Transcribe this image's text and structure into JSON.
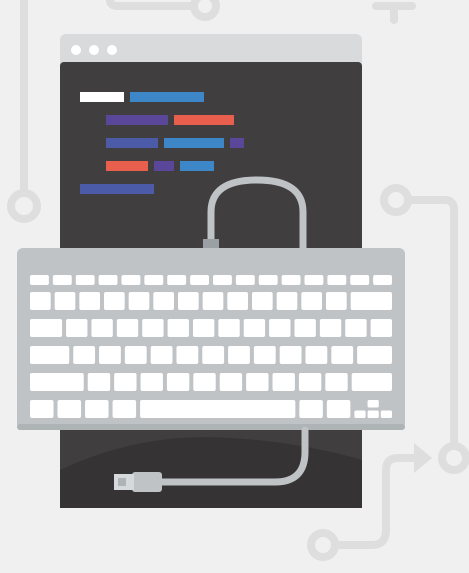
{
  "illustration": {
    "colors": {
      "background": "#f0f0f0",
      "circuit": "#dedede",
      "window_titlebar": "#d9dadb",
      "window_body": "#403e3f",
      "titlebar_dots": "#ffffff",
      "keyboard_body": "#bfc3c6",
      "keyboard_keys": "#ffffff",
      "cable": "#bfc3c6",
      "code_white": "#ffffff",
      "code_blue": "#3d87c8",
      "code_purple": "#5b479a",
      "code_red": "#e8604d",
      "code_navy": "#4b5ba8"
    },
    "window": {
      "titlebar_dots": 3
    },
    "code_lines": [
      {
        "indent": 0,
        "tokens": [
          {
            "color": "code_white"
          },
          {
            "color": "code_blue"
          }
        ]
      },
      {
        "indent": 1,
        "tokens": [
          {
            "color": "code_purple"
          },
          {
            "color": "code_red"
          }
        ]
      },
      {
        "indent": 1,
        "tokens": [
          {
            "color": "code_navy"
          },
          {
            "color": "code_blue"
          },
          {
            "color": "code_purple"
          }
        ]
      },
      {
        "indent": 1,
        "tokens": [
          {
            "color": "code_red"
          },
          {
            "color": "code_purple"
          },
          {
            "color": "code_blue"
          }
        ]
      },
      {
        "indent": 0,
        "tokens": [
          {
            "color": "code_navy"
          }
        ]
      }
    ],
    "keyboard": {
      "rows": [
        {
          "kind": "function",
          "key_units": [
            1,
            1,
            1,
            1,
            1,
            1,
            1,
            1,
            1,
            1,
            1,
            1,
            1,
            1,
            1,
            1
          ]
        },
        {
          "kind": "number",
          "key_units": [
            1,
            1,
            1,
            1,
            1,
            1,
            1,
            1,
            1,
            1,
            1,
            1,
            1,
            2
          ]
        },
        {
          "kind": "top-letters",
          "key_units": [
            1.5,
            1,
            1,
            1,
            1,
            1,
            1,
            1,
            1,
            1,
            1,
            1,
            1,
            1
          ]
        },
        {
          "kind": "home-row",
          "key_units": [
            1.8,
            1,
            1,
            1,
            1,
            1,
            1,
            1,
            1,
            1,
            1,
            1,
            1.6
          ]
        },
        {
          "kind": "bottom-letters",
          "key_units": [
            2.4,
            1,
            1,
            1,
            1,
            1,
            1,
            1,
            1,
            1,
            1,
            1.8
          ]
        },
        {
          "kind": "space-row",
          "key_units": [
            1,
            1,
            1,
            1,
            6.6,
            1,
            1,
            1.6
          ]
        }
      ]
    }
  }
}
